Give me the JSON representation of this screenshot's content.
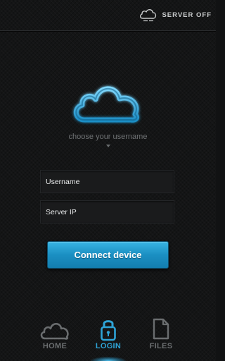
{
  "server_status": {
    "label": "SERVER OFF",
    "icon": "cloud-off-icon"
  },
  "login": {
    "hero_icon": "cloud-icon",
    "username_picker": {
      "label": "choose your username",
      "icon": "dropdown-arrow-icon"
    },
    "username_field": {
      "placeholder": "Username",
      "value": ""
    },
    "server_ip_field": {
      "placeholder": "Server IP",
      "value": ""
    },
    "connect_button": {
      "label": "Connect device"
    }
  },
  "bottom_nav": {
    "tabs": [
      {
        "label": "HOME",
        "icon": "cloud-icon",
        "active": false
      },
      {
        "label": "LOGIN",
        "icon": "lock-icon",
        "active": true
      },
      {
        "label": "FILES",
        "icon": "file-icon",
        "active": false
      }
    ]
  },
  "colors": {
    "accent": "#2ea3d6",
    "background": "#141516",
    "button": "#1b8fc2",
    "inactive": "#6a6d6f"
  }
}
